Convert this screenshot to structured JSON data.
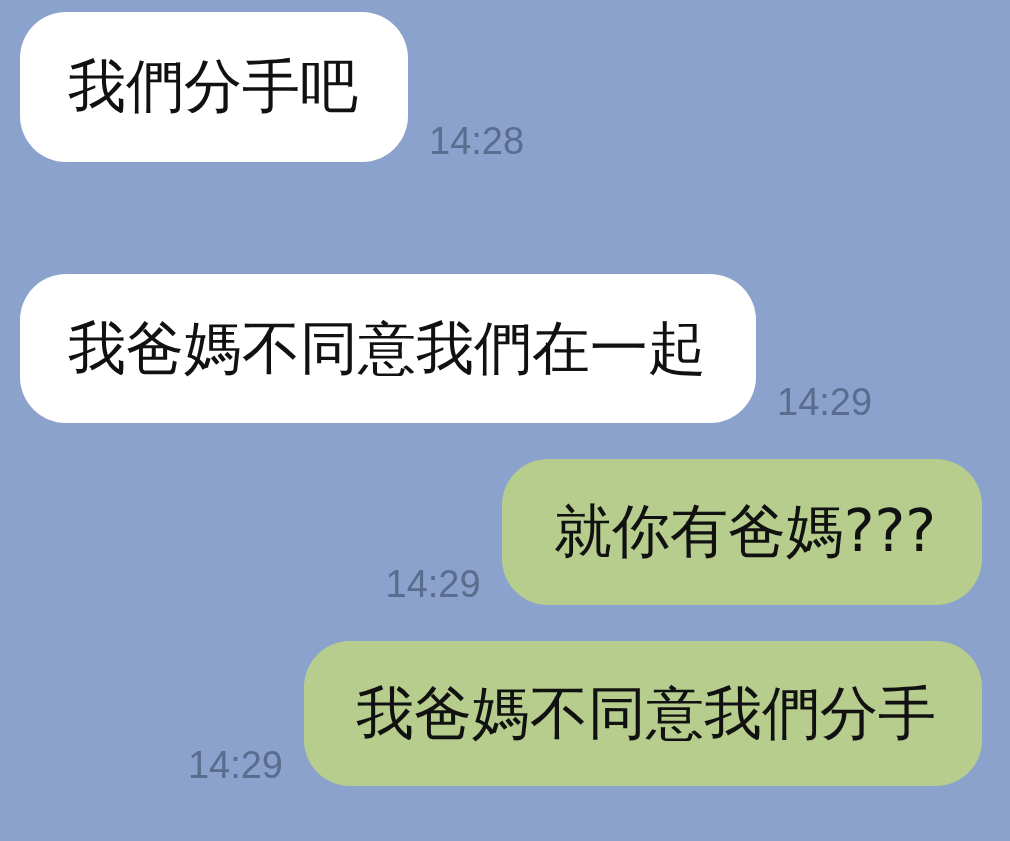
{
  "messages": [
    {
      "kind": "received",
      "text": "我們分手吧",
      "time": "14:28"
    },
    {
      "kind": "received",
      "text": "我爸媽不同意我們在一起",
      "time": "14:29"
    },
    {
      "kind": "sent",
      "text": "就你有爸媽???",
      "time": "14:29"
    },
    {
      "kind": "sent",
      "text": "我爸媽不同意我們分手",
      "time": "14:29"
    }
  ]
}
